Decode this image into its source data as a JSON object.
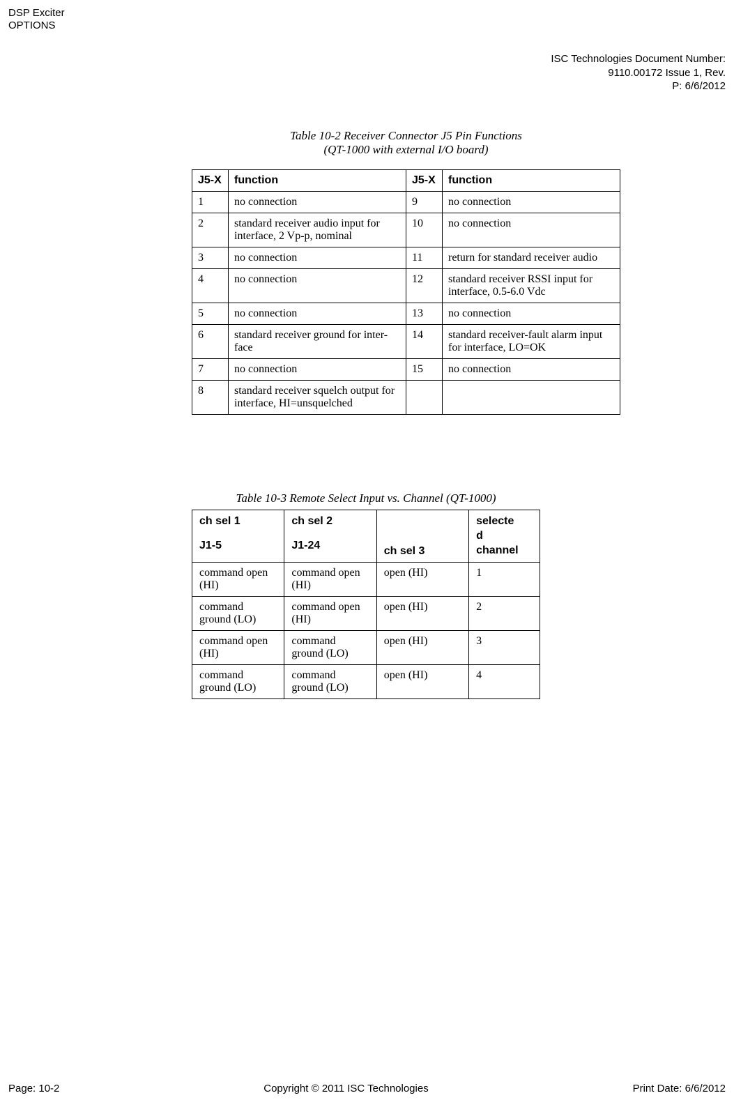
{
  "header": {
    "title_line1": "DSP Exciter",
    "title_line2": "OPTIONS",
    "doc_label": "ISC Technologies Document Number:",
    "doc_number": "9110.00172 Issue 1, Rev.",
    "doc_date": "P: 6/6/2012"
  },
  "table1": {
    "caption_line1": "Table 10-2 Receiver Connector J5 Pin Functions",
    "caption_line2": "(QT-1000 with external I/O board)",
    "headers": [
      "J5-X",
      "function",
      "J5-X",
      "function"
    ],
    "rows": [
      [
        "1",
        "no connection",
        "9",
        "no connection"
      ],
      [
        "2",
        "standard receiver audio input for interface, 2 Vp-p, nominal",
        "10",
        "no connection"
      ],
      [
        "3",
        "no connection",
        "11",
        "return for standard receiver audio"
      ],
      [
        "4",
        "no connection",
        "12",
        "standard receiver RSSI input for interface, 0.5-6.0 Vdc"
      ],
      [
        "5",
        "no connection",
        "13",
        "no connection"
      ],
      [
        "6",
        "standard receiver ground for inter-face",
        "14",
        "standard receiver-fault alarm input for interface, LO=OK"
      ],
      [
        "7",
        "no connection",
        "15",
        "no connection"
      ],
      [
        "8",
        "standard receiver squelch output for interface, HI=unsquelched",
        "",
        ""
      ]
    ]
  },
  "table2": {
    "caption": "Table 10-3 Remote Select Input vs. Channel (QT-1000)",
    "headers": {
      "h1_line1": "ch sel 1",
      "h1_line2": "J1-5",
      "h2_line1": "ch sel 2",
      "h2_line2": "J1-24",
      "h3": "ch sel 3",
      "h4_line1": "selecte",
      "h4_line2": "d",
      "h4_line3": "channel"
    },
    "rows": [
      [
        "command open (HI)",
        "command open (HI)",
        "open (HI)",
        "1"
      ],
      [
        "command ground (LO)",
        "command open (HI)",
        "open (HI)",
        "2"
      ],
      [
        "command open (HI)",
        "command ground (LO)",
        "open (HI)",
        "3"
      ],
      [
        "command ground (LO)",
        "command ground (LO)",
        "open (HI)",
        "4"
      ]
    ]
  },
  "footer": {
    "page": "Page: 10-2",
    "copyright": "Copyright © 2011 ISC Technologies",
    "print_date": "Print Date: 6/6/2012"
  }
}
